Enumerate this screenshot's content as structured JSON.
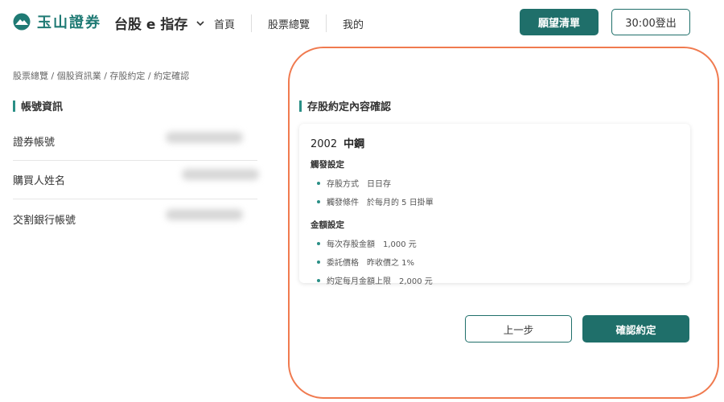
{
  "brand": {
    "logo_text": "玉山證券",
    "accent_color": "#1f6f6a"
  },
  "header": {
    "product": "台股 e 指存",
    "nav": [
      "首頁",
      "股票總覽",
      "我的"
    ],
    "wishlist_label": "願望清單",
    "logout_label": "30:00登出"
  },
  "breadcrumb": "股票總覽 / 個股資訊業 / 存股約定 / 約定確認",
  "account": {
    "title": "帳號資訊",
    "rows": [
      {
        "label": "證券帳號"
      },
      {
        "label": "購買人姓名"
      },
      {
        "label": "交割銀行帳號"
      }
    ]
  },
  "confirm": {
    "title": "存股約定內容確認",
    "stock_code": "2002",
    "stock_name": "中鋼",
    "trigger": {
      "title": "觸發設定",
      "items": [
        {
          "key": "存股方式",
          "value": "日日存"
        },
        {
          "key": "觸發條件",
          "value": "於每月的 5 日掛單"
        }
      ]
    },
    "amount": {
      "title": "金額設定",
      "items": [
        {
          "key": "每次存股金額",
          "value": "1,000 元"
        },
        {
          "key": "委託價格",
          "value": "昨收價之 1%"
        },
        {
          "key": "約定每月金額上限",
          "value": "2,000 元"
        }
      ]
    }
  },
  "actions": {
    "prev_label": "上一步",
    "confirm_label": "確認約定"
  }
}
